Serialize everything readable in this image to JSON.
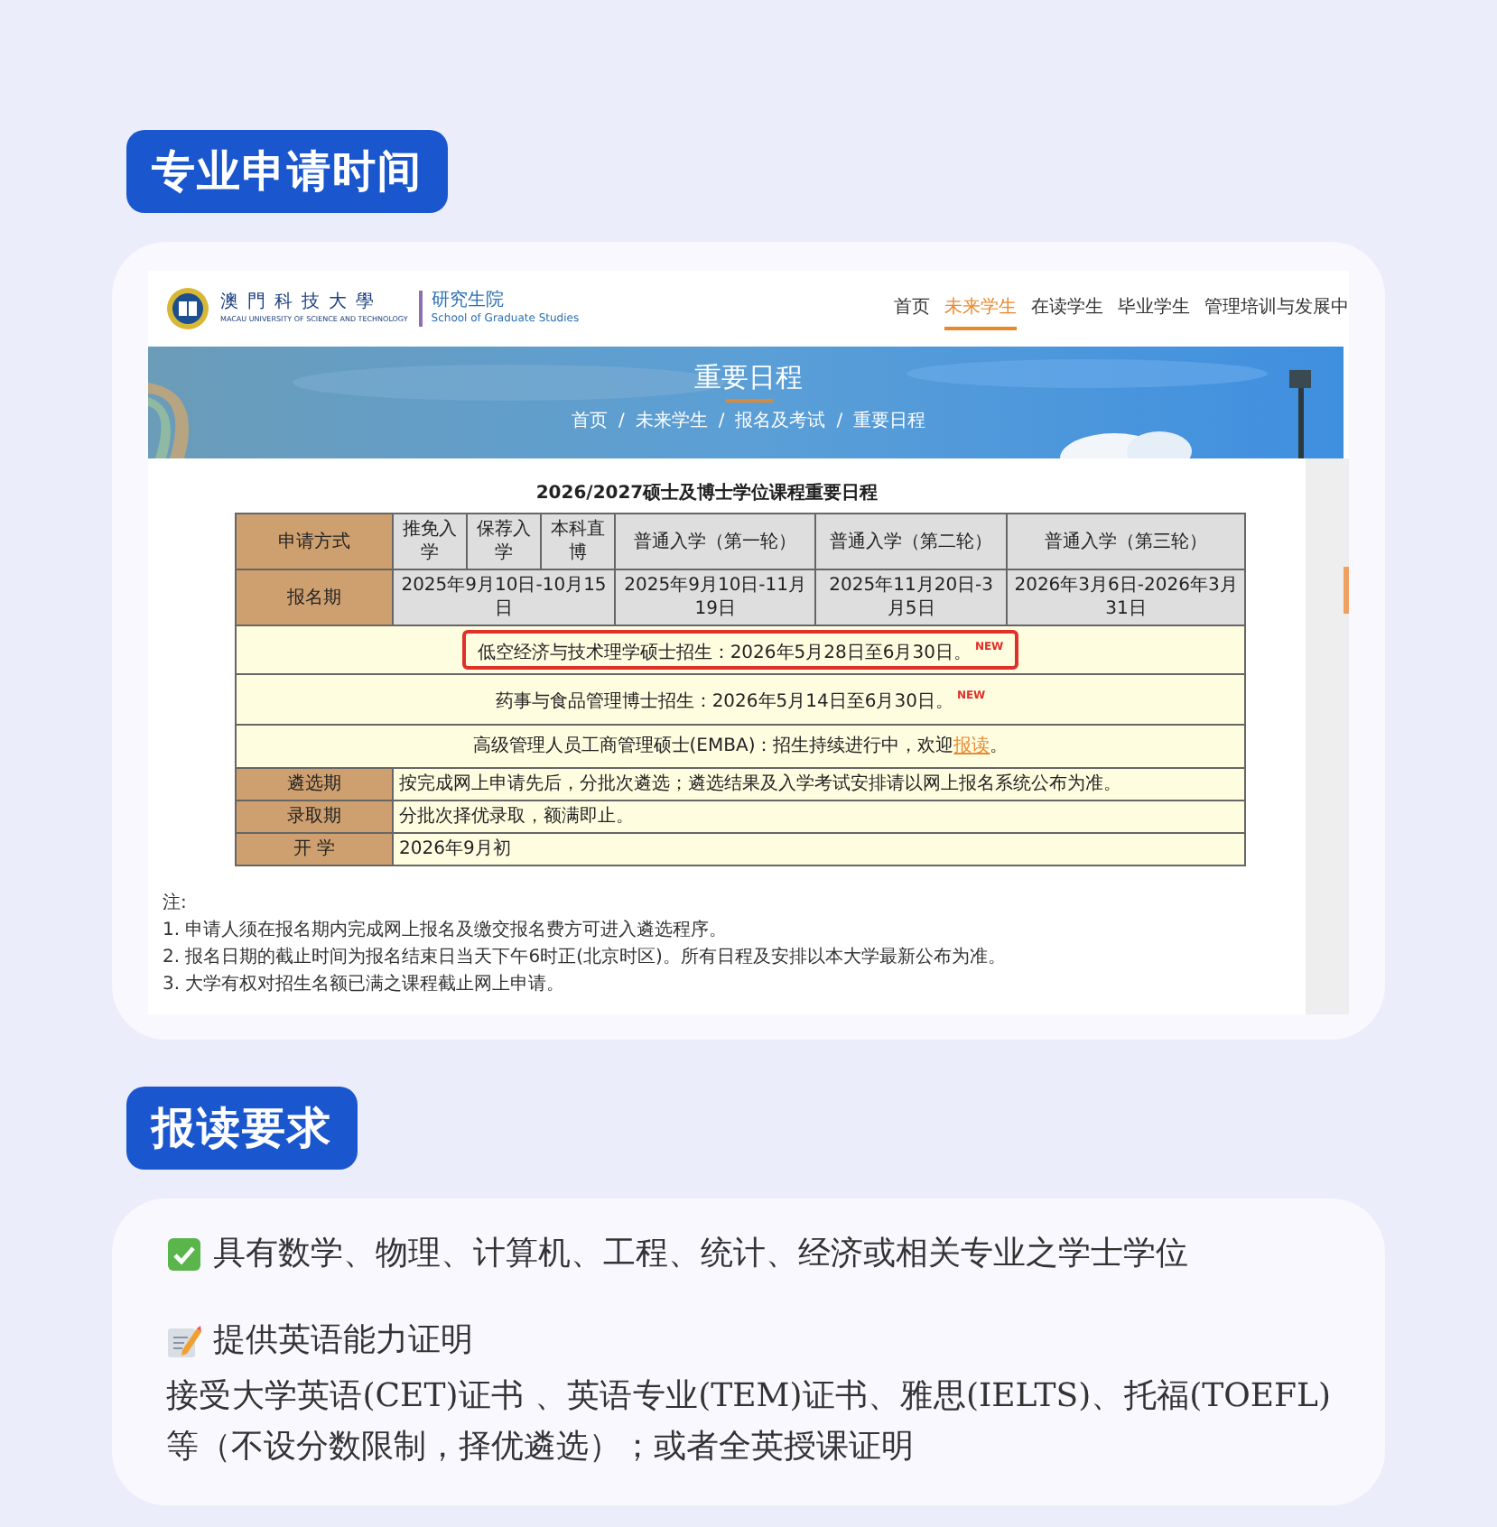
{
  "schedule_section": {
    "title": "专业申请时间",
    "website": {
      "logo": {
        "name_cn": "澳門科技大學",
        "name_en": "MACAU UNIVERSITY OF SCIENCE AND TECHNOLOGY",
        "school_cn": "研究生院",
        "school_en": "School of Graduate Studies"
      },
      "nav": [
        {
          "label": "首页",
          "selected": false
        },
        {
          "label": "未来学生",
          "selected": true
        },
        {
          "label": "在读学生",
          "selected": false
        },
        {
          "label": "毕业学生",
          "selected": false
        },
        {
          "label": "管理培训与发展中",
          "selected": false
        }
      ],
      "banner": {
        "title": "重要日程",
        "separator": "/",
        "breadcrumb": [
          "首页",
          "未来学生",
          "报名及考试",
          "重要日程"
        ]
      },
      "table": {
        "title": "2026/2027硕士及博士学位课程重要日程",
        "header": {
          "label": "申请方式",
          "cells": [
            "推免入学",
            "保荐入学",
            "本科直博",
            "普通入学（第一轮）",
            "普通入学（第二轮）",
            "普通入学（第三轮）"
          ]
        },
        "rows": [
          {
            "kind": "dates",
            "label": "报名期",
            "cells": [
              {
                "text": "2025年9月10日-10月15日",
                "merged": true
              },
              {
                "text": "2025年9月10日-11月19日",
                "merged": false
              },
              {
                "text": "2025年11月20日-3月5日",
                "merged": false
              },
              {
                "text": "2026年3月6日-2026年3月31日",
                "merged": false
              }
            ]
          },
          {
            "kind": "notice",
            "text": "低空经济与技术理学硕士招生：2026年5月28日至6月30日。",
            "badge": "NEW",
            "highlighted": true
          },
          {
            "kind": "notice",
            "text": "药事与食品管理博士招生：2026年5月14日至6月30日。",
            "badge": "NEW",
            "highlighted": false
          },
          {
            "kind": "notice",
            "text": "高级管理人员工商管理硕士(EMBA)：招生持续进行中，欢迎",
            "link": "报读",
            "suffix": "。",
            "highlighted": false
          },
          {
            "kind": "info",
            "label": "遴选期",
            "text": "按完成网上申请先后，分批次遴选；遴选结果及入学考试安排请以网上报名系统公布为准。"
          },
          {
            "kind": "info",
            "label": "录取期",
            "text": "分批次择优录取，额满即止。"
          },
          {
            "kind": "info",
            "label": "开 学",
            "text": "2026年9月初"
          }
        ]
      },
      "notes": {
        "title": "注:",
        "items": [
          "1. 申请人须在报名期内完成网上报名及缴交报名费方可进入遴选程序。",
          "2. 报名日期的截止时间为报名结束日当天下午6时正(北京时区)。所有日程及安排以本大学最新公布为准。",
          "3. 大学有权对招生名额已满之课程截止网上申请。"
        ]
      }
    }
  },
  "requirements_section": {
    "title": "报读要求",
    "items": [
      {
        "kind": "check",
        "text": "具有数学、物理、计算机、工程、统计、经济或相关专业之学士学位"
      },
      {
        "kind": "memo",
        "text": "提供英语能力证明",
        "detail": "接受大学英语(CET)证书 、英语专业(TEM)证书、雅思(IELTS)、托福(TOEFL)等（不设分数限制，择优遴选）；或者全英授课证明"
      }
    ]
  }
}
